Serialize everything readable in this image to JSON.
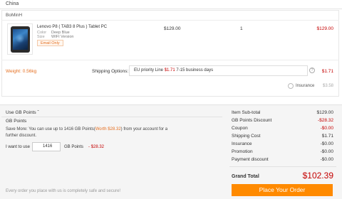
{
  "address": {
    "country": "China"
  },
  "seller": {
    "name": "BoMinH"
  },
  "item": {
    "name": "Lenovo P8 ( TAB3 8 Plus ) Tablet PC",
    "color_label": "Color",
    "color_value": "Deep Blue",
    "size_label": "Size",
    "size_value": "WIFI Version",
    "badge": "Email Only",
    "unit_price": "$129.00",
    "quantity": "1",
    "subtotal": "$129.00"
  },
  "shipping": {
    "weight": "Weight: 0.56kg",
    "label": "Shipping Options:",
    "method": "EU priority Line",
    "method_price": "$1.71",
    "method_time": "7-15 business days",
    "cost": "$1.71",
    "help_icon": "question-circle-icon"
  },
  "insurance": {
    "label": "Insurance",
    "cost": "$3.58",
    "checked": false
  },
  "gb_points": {
    "toggle_label": "Use GB Points",
    "toggle_icon": "chevron-down-icon",
    "title": "GB Points",
    "desc_prefix": "Save More: You can use up to 1416 GB Points(",
    "desc_worth": "Worth $28.32",
    "desc_suffix": ") from your account for a further discount.",
    "want_label": "I want to use",
    "input_value": "1416",
    "unit": "GB Points",
    "discount": "- $28.32"
  },
  "summary": {
    "rows": [
      {
        "label": "Item Sub-total",
        "value": "$129.00",
        "red": false
      },
      {
        "label": "GB Points Discount",
        "value": "-$28.32",
        "red": true
      },
      {
        "label": "Coupon",
        "value": "-$0.00",
        "red": true
      },
      {
        "label": "Shipping Cost",
        "value": "$1.71",
        "red": false
      },
      {
        "label": "Insurance",
        "value": "-$0.00",
        "red": false
      },
      {
        "label": "Promotion",
        "value": "-$0.00",
        "red": false
      },
      {
        "label": "Payment discount",
        "value": "-$0.00",
        "red": false
      }
    ],
    "grand_total_label": "Grand Total",
    "grand_total_value": "$102.39"
  },
  "order_button": {
    "label": "Place Your Order"
  },
  "footer": {
    "secure_text": "Every order you place with us is completely safe and secure!"
  },
  "colors": {
    "accent": "#ff8a00",
    "price_red": "#c40000",
    "weight_orange": "#e56f20"
  }
}
